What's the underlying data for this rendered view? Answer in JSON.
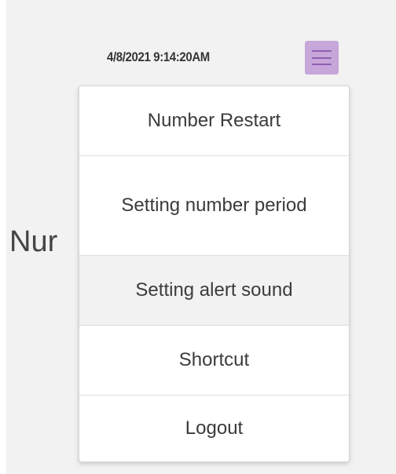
{
  "header": {
    "datetime": "4/8/2021 9:14:20AM",
    "menu_icon": "hamburger-menu-icon",
    "menu_button_color": "#c7a6d9",
    "menu_icon_color": "#8f5fb0"
  },
  "main": {
    "heading_partial": "Nur"
  },
  "dropdown": {
    "items": [
      {
        "label": "Number Restart",
        "state": "normal"
      },
      {
        "label": "Setting number period",
        "state": "normal"
      },
      {
        "label": "Setting alert sound",
        "state": "hover"
      },
      {
        "label": "Shortcut",
        "state": "normal"
      },
      {
        "label": "Logout",
        "state": "normal"
      }
    ]
  },
  "colors": {
    "background": "#f2f2f2",
    "menu_background": "#ffffff",
    "hover_background": "#f2f2f2",
    "text": "#3b3b3b"
  }
}
